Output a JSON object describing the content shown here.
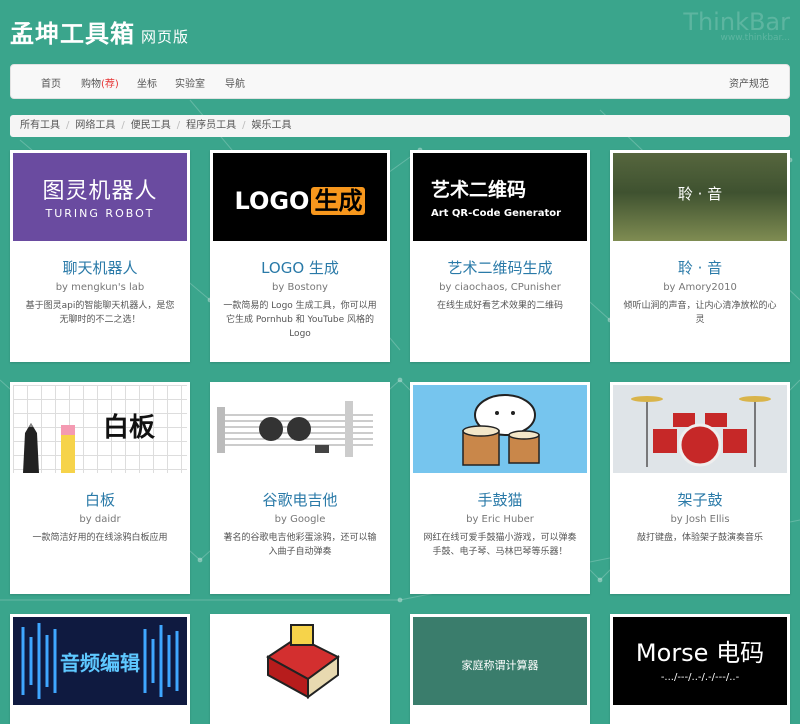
{
  "header": {
    "title": "孟坤工具箱",
    "subtitle": "网页版",
    "watermark": "ThinkBar",
    "watermark_sub": "www.thinkbar..."
  },
  "nav": {
    "items": [
      "首页",
      "购物",
      "坐标",
      "实验室",
      "导航"
    ],
    "shop_badge": "(荐)",
    "right": "资产规范"
  },
  "breadcrumb": [
    "所有工具",
    "网络工具",
    "便民工具",
    "程序员工具",
    "娱乐工具"
  ],
  "cards": [
    {
      "title": "聊天机器人",
      "author": "by mengkun's lab",
      "desc": "基于图灵api的智能聊天机器人，是您无聊时的不二之选！",
      "thumb_text": "图灵机器人",
      "thumb_sub": "TURING ROBOT"
    },
    {
      "title": "LOGO 生成",
      "author": "by Bostony",
      "desc": "一款简易的 Logo 生成工具，你可以用它生成 Pornhub 和 YouTube 风格的 Logo",
      "thumb_text": "LOGO",
      "thumb_sub": "生成"
    },
    {
      "title": "艺术二维码生成",
      "author": "by ciaochaos, CPunisher",
      "desc": "在线生成好看艺术效果的二维码",
      "thumb_text": "艺术二维码",
      "thumb_sub": "Art QR-Code Generator"
    },
    {
      "title": "聆 · 音",
      "author": "by Amory2010",
      "desc": "倾听山涧的声音，让内心清净放松的心灵",
      "thumb_text": "聆 · 音",
      "thumb_sub": ""
    },
    {
      "title": "白板",
      "author": "by daidr",
      "desc": "一款简洁好用的在线涂鸦白板应用",
      "thumb_text": "白板",
      "thumb_sub": ""
    },
    {
      "title": "谷歌电吉他",
      "author": "by Google",
      "desc": "著名的谷歌电吉他彩蛋涂鸦，还可以输入曲子自动弹奏",
      "thumb_text": "",
      "thumb_sub": ""
    },
    {
      "title": "手鼓猫",
      "author": "by Eric Huber",
      "desc": "网红在线可爱手鼓猫小游戏，可以弹奏手鼓、电子琴、马林巴琴等乐器！",
      "thumb_text": "",
      "thumb_sub": ""
    },
    {
      "title": "架子鼓",
      "author": "by Josh Ellis",
      "desc": "敲打键盘，体验架子鼓演奏音乐",
      "thumb_text": "",
      "thumb_sub": ""
    },
    {
      "title": "音频编辑",
      "author": "",
      "desc": "",
      "thumb_text": "音频编辑",
      "thumb_sub": ""
    },
    {
      "title": "",
      "author": "",
      "desc": "",
      "thumb_text": "",
      "thumb_sub": ""
    },
    {
      "title": "",
      "author": "",
      "desc": "",
      "thumb_text": "家庭称谓计算器",
      "thumb_sub": ""
    },
    {
      "title": "",
      "author": "",
      "desc": "",
      "thumb_text": "Morse 电码",
      "thumb_sub": "-.../---/..-/.-/---/..-"
    }
  ]
}
